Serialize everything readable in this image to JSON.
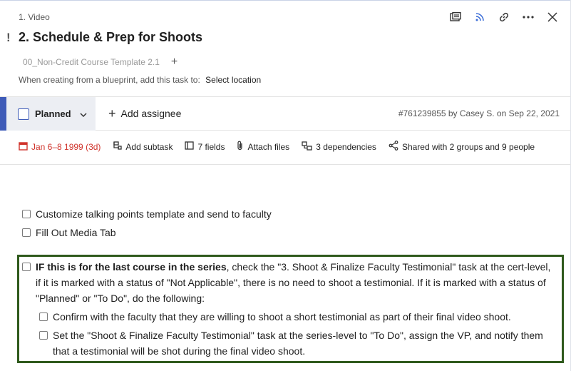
{
  "breadcrumb": "1. Video",
  "title": "2. Schedule & Prep for Shoots",
  "important_marker": "!",
  "header_icons": [
    "widget-icon",
    "rss-icon",
    "link-icon",
    "more-icon",
    "close-icon"
  ],
  "blueprint": {
    "tag": "00_Non-Credit Course Template 2.1",
    "add": "+"
  },
  "creating": {
    "label": "When creating from a blueprint, add this task to:",
    "location": "Select location"
  },
  "status": {
    "label": "Planned",
    "accent_color": "#3e5bb8"
  },
  "assignee": {
    "label": "Add assignee"
  },
  "task_meta": "#761239855 by Casey S. on Sep 22, 2021",
  "actions": {
    "date": "Jan 6–8 1999 (3d)",
    "subtask": "Add subtask",
    "fields": "7 fields",
    "attach": "Attach files",
    "dependencies": "3 dependencies",
    "shared": "Shared with 2 groups and 9 people"
  },
  "checklist": [
    {
      "text": "Customize talking points template and send to faculty"
    },
    {
      "text": "Fill Out Media Tab"
    }
  ],
  "highlight": {
    "bold": "IF this is for the last course in the series",
    "rest": ", check the \"3. Shoot & Finalize Faculty Testimonial\" task at the cert-level, if it is marked with a status of \"Not Applicable\", there is no need to shoot a testimonial. If it is marked with a status of \"Planned\" or \"To Do\", do the following:",
    "border_color": "#2f5a1c",
    "sub_items": [
      {
        "text": "Confirm with the faculty that they are willing to shoot a short testimonial as part of their final video shoot."
      },
      {
        "text": "Set the \"Shoot & Finalize Faculty Testimonial\" task at the series-level to \"To Do\", assign the VP, and notify them that a testimonial will be shot during the final video shoot."
      }
    ]
  }
}
